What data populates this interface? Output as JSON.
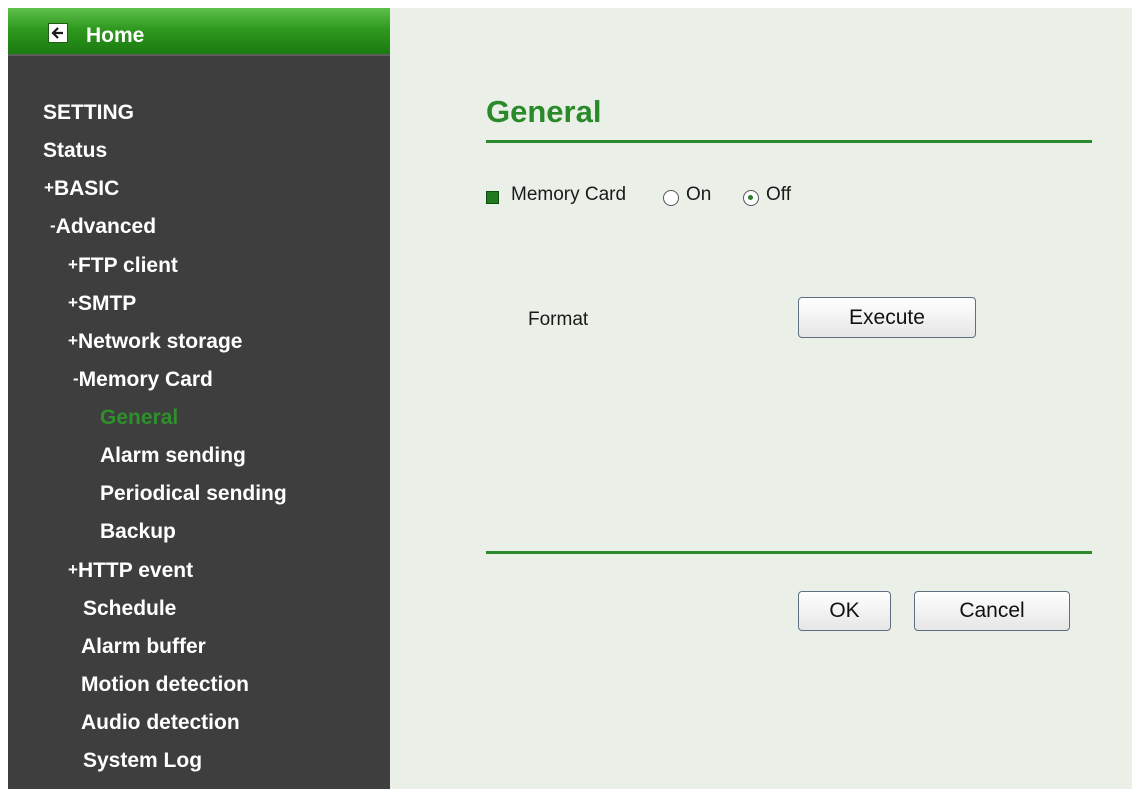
{
  "sidebar": {
    "home_label": "Home",
    "items": [
      {
        "prefix": "",
        "label": "SETTING"
      },
      {
        "prefix": "",
        "label": "Status"
      },
      {
        "prefix": "+",
        "label": "BASIC"
      },
      {
        "prefix": "-",
        "label": "Advanced"
      },
      {
        "prefix": "+",
        "label": "FTP client"
      },
      {
        "prefix": "+",
        "label": "SMTP"
      },
      {
        "prefix": "+",
        "label": "Network storage"
      },
      {
        "prefix": "-",
        "label": "Memory Card"
      },
      {
        "prefix": "",
        "label": "General"
      },
      {
        "prefix": "",
        "label": "Alarm sending"
      },
      {
        "prefix": "",
        "label": "Periodical sending"
      },
      {
        "prefix": "",
        "label": "Backup"
      },
      {
        "prefix": "+",
        "label": "HTTP event"
      },
      {
        "prefix": "",
        "label": "Schedule"
      },
      {
        "prefix": "",
        "label": "Alarm buffer"
      },
      {
        "prefix": "",
        "label": "Motion detection"
      },
      {
        "prefix": "",
        "label": "Audio detection"
      },
      {
        "prefix": "",
        "label": "System Log"
      }
    ],
    "active_item": "General"
  },
  "main": {
    "title": "General",
    "memory_card": {
      "label": "Memory Card",
      "on_label": "On",
      "off_label": "Off",
      "selected": "Off"
    },
    "format": {
      "label": "Format",
      "button_label": "Execute"
    },
    "ok_label": "OK",
    "cancel_label": "Cancel"
  },
  "colors": {
    "accent": "#2a8a2a",
    "sidebar_bg": "#3e3e3e",
    "main_bg": "#eaf0e8"
  },
  "icons": {
    "home": "back-arrow-icon",
    "bullet": "green-square-bullet-icon"
  }
}
